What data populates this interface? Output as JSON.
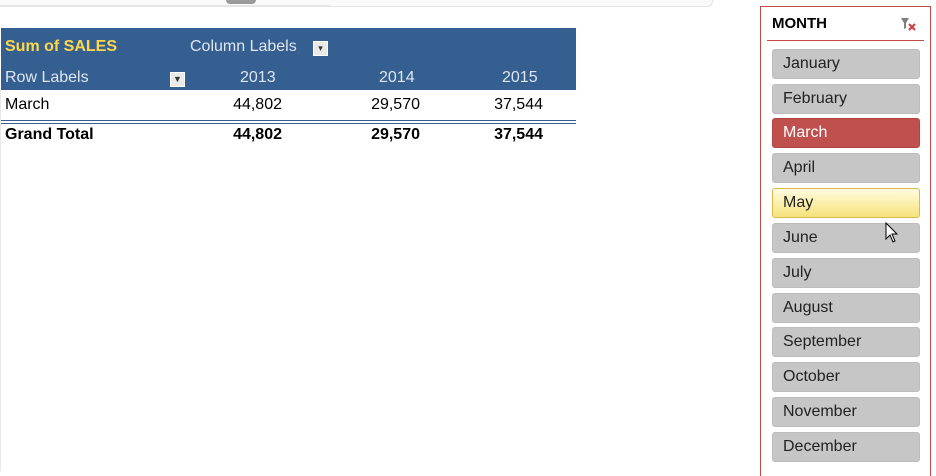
{
  "pivot": {
    "value_field": "Sum of SALES",
    "column_labels": "Column Labels",
    "row_labels": "Row Labels",
    "years": [
      "2013",
      "2014",
      "2015"
    ],
    "rows": [
      {
        "label": "March",
        "values": [
          "44,802",
          "29,570",
          "37,544"
        ]
      }
    ],
    "grand_total": {
      "label": "Grand Total",
      "values": [
        "44,802",
        "29,570",
        "37,544"
      ]
    }
  },
  "slicer": {
    "title": "MONTH",
    "items": [
      {
        "label": "January",
        "state": "normal"
      },
      {
        "label": "February",
        "state": "normal"
      },
      {
        "label": "March",
        "state": "selected"
      },
      {
        "label": "April",
        "state": "normal"
      },
      {
        "label": "May",
        "state": "hover"
      },
      {
        "label": "June",
        "state": "normal"
      },
      {
        "label": "July",
        "state": "normal"
      },
      {
        "label": "August",
        "state": "normal"
      },
      {
        "label": "September",
        "state": "normal"
      },
      {
        "label": "October",
        "state": "normal"
      },
      {
        "label": "November",
        "state": "normal"
      },
      {
        "label": "December",
        "state": "normal"
      }
    ],
    "colors": {
      "selected": "#c0504d",
      "border": "#c64a4a",
      "normal": "#c6c6c6",
      "header": "#355f91"
    }
  },
  "icons": {
    "clear_filter": "clear-filter-icon",
    "dropdown": "dropdown-arrow-icon",
    "filter": "filter-icon",
    "cursor": "mouse-pointer-icon"
  }
}
